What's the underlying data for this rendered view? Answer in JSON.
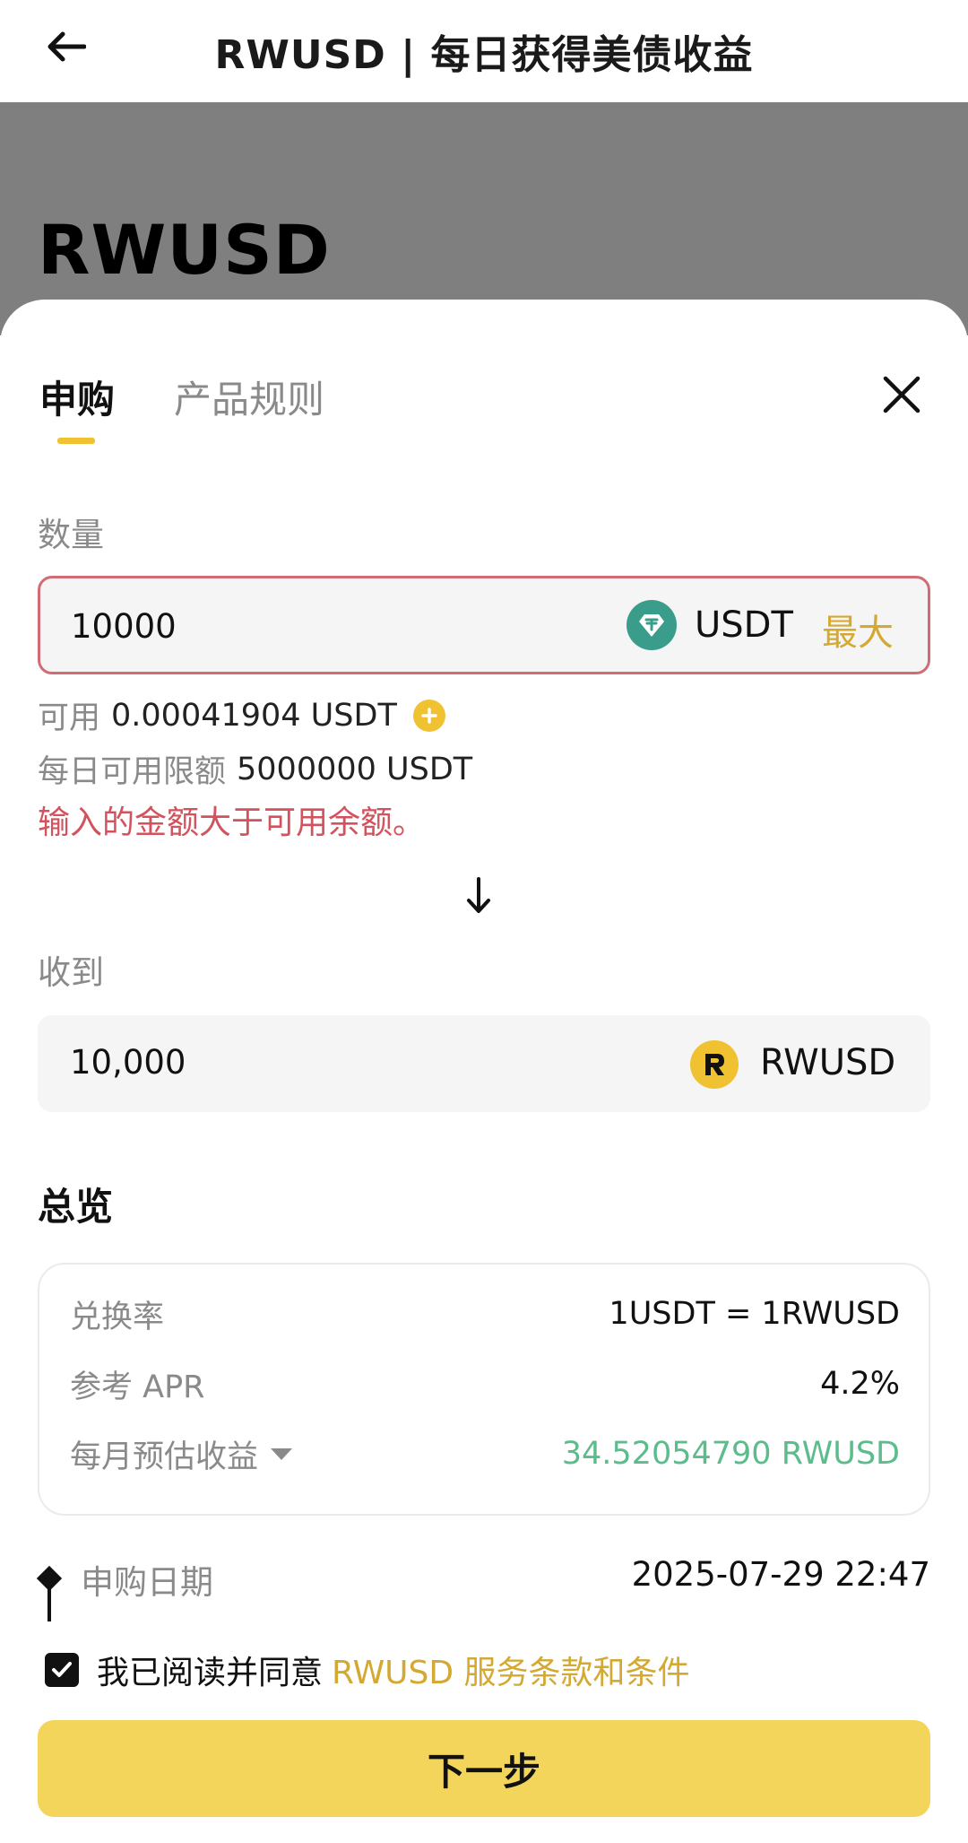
{
  "header": {
    "title": "RWUSD | 每日获得美债收益",
    "back_icon": "arrow-left-icon"
  },
  "hero": {
    "title": "RWUSD"
  },
  "tabs": [
    {
      "label": "申购",
      "active": true
    },
    {
      "label": "产品规则",
      "active": false
    }
  ],
  "subscribe": {
    "quantity_label": "数量",
    "amount_value": "10000",
    "amount_token": "USDT",
    "max_label": "最大",
    "available_label": "可用",
    "available_value": "0.00041904 USDT",
    "daily_limit_label": "每日可用限额",
    "daily_limit_value": "5000000 USDT",
    "error_message": "输入的金额大于可用余额。",
    "receive_label": "收到",
    "receive_value": "10,000",
    "receive_token": "RWUSD"
  },
  "overview": {
    "title": "总览",
    "rows": [
      {
        "label": "兑换率",
        "value": "1USDT = 1RWUSD"
      },
      {
        "label": "参考 APR",
        "value": "4.2%"
      },
      {
        "label": "每月预估收益",
        "value": "34.52054790 RWUSD"
      }
    ]
  },
  "subscription_date": {
    "label": "申购日期",
    "value": "2025-07-29 22:47"
  },
  "agreement": {
    "text": "我已阅读并同意",
    "link": "RWUSD 服务条款和条件",
    "checked": true
  },
  "next_button": {
    "label": "下一步"
  },
  "colors": {
    "accent_yellow": "#f0c232",
    "error_red": "#d2525e",
    "positive_green": "#5cbc8c",
    "usdt_green": "#3a9c8a"
  }
}
